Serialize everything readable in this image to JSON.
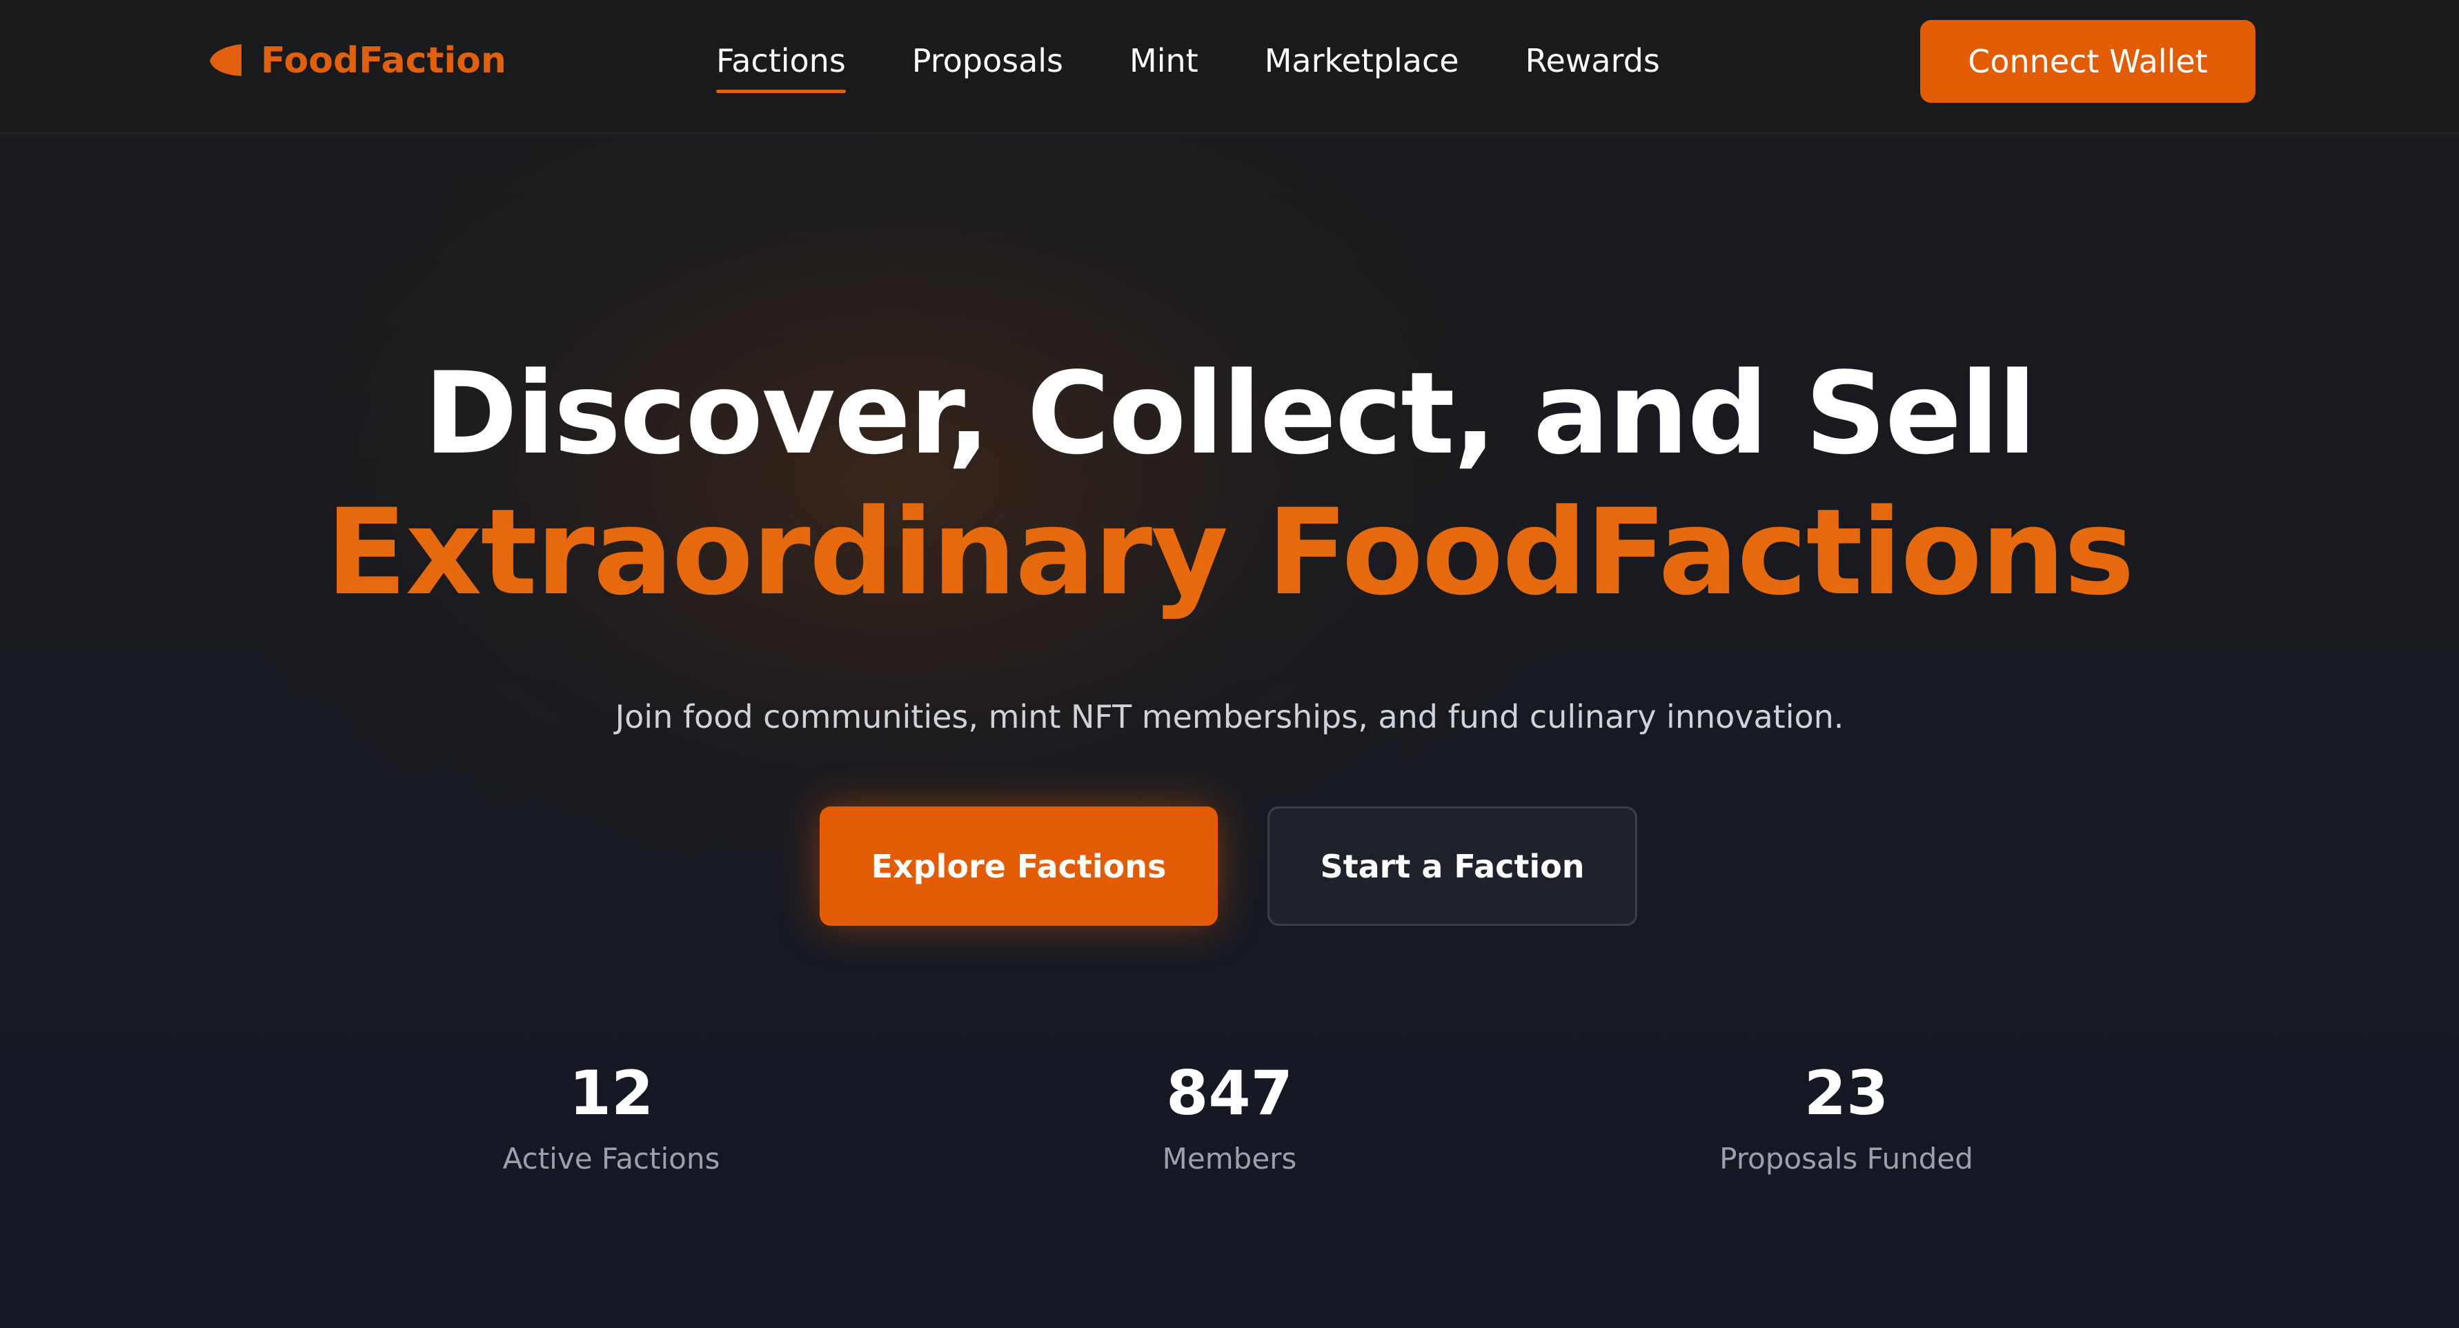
{
  "header": {
    "brand": {
      "name": "FoodFaction",
      "icon": "leaf-icon",
      "color": "#e0600c"
    },
    "nav": [
      {
        "label": "Factions",
        "active": true
      },
      {
        "label": "Proposals",
        "active": false
      },
      {
        "label": "Mint",
        "active": false
      },
      {
        "label": "Marketplace",
        "active": false
      },
      {
        "label": "Rewards",
        "active": false
      }
    ],
    "connect_wallet_label": "Connect Wallet"
  },
  "hero": {
    "title_line1": "Discover, Collect, and Sell",
    "title_line2": "Extraordinary FoodFactions",
    "subtitle": "Join food communities, mint NFT memberships, and fund culinary innovation.",
    "primary_cta": "Explore Factions",
    "secondary_cta": "Start a Faction"
  },
  "stats": [
    {
      "value": "12",
      "label": "Active Factions"
    },
    {
      "value": "847",
      "label": "Members"
    },
    {
      "value": "23",
      "label": "Proposals Funded"
    }
  ],
  "colors": {
    "accent": "#e35c04",
    "highlight_text": "#e6690e",
    "background": "#151821",
    "nav_background": "#191a1c"
  }
}
